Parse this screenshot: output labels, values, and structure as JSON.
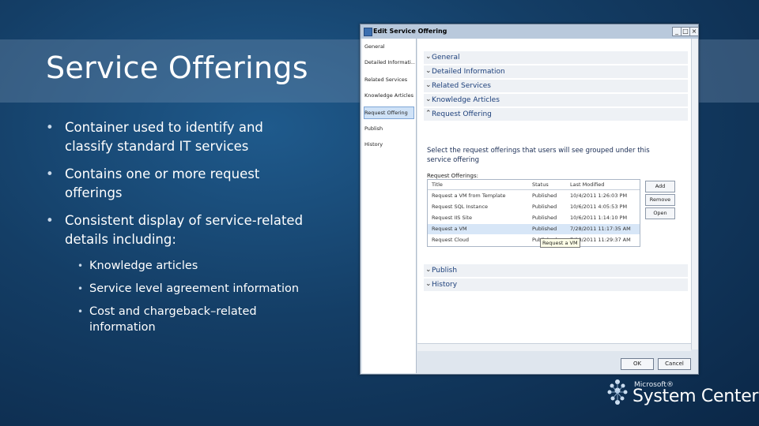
{
  "slide": {
    "title": "Service Offerings",
    "bullets": [
      {
        "text": "Container used to identify and classify standard IT services"
      },
      {
        "text": "Contains one or more request offerings"
      },
      {
        "text": "Consistent display of service-related details including:"
      }
    ],
    "sub_bullets": [
      {
        "text": "Knowledge articles"
      },
      {
        "text": "Service level agreement information"
      },
      {
        "text": "Cost and chargeback–related information"
      }
    ]
  },
  "dialog": {
    "title": "Edit Service Offering",
    "title_buttons": [
      "_",
      "□",
      "×"
    ],
    "nav": [
      "General",
      "Detailed Informati...",
      "Related Services",
      "Knowledge Articles",
      "Request Offering",
      "Publish",
      "History"
    ],
    "nav_selected": "Request Offering",
    "sections_top": [
      "General",
      "Detailed Information",
      "Related Services",
      "Knowledge Articles",
      "Request Offering"
    ],
    "description": "Select the request offerings that users will see grouped under this service offering",
    "grid_label": "Request Offerings:",
    "grid_columns": [
      "Title",
      "Status",
      "Last Modified"
    ],
    "grid_rows": [
      {
        "title": "Request a VM from Template",
        "status": "Published",
        "modified": "10/4/2011 1:26:03 PM"
      },
      {
        "title": "Request SQL Instance",
        "status": "Published",
        "modified": "10/6/2011 4:05:53 PM"
      },
      {
        "title": "Request IIS Site",
        "status": "Published",
        "modified": "10/6/2011 1:14:10 PM"
      },
      {
        "title": "Request a VM",
        "status": "Published",
        "modified": "7/28/2011 11:17:35 AM"
      },
      {
        "title": "Request Cloud",
        "status": "Published",
        "modified": "7/28/2011 11:29:37 AM"
      }
    ],
    "selected_row": "Request a VM",
    "tooltip": "Request a VM",
    "side_buttons": [
      "Add",
      "Remove",
      "Open"
    ],
    "sections_bottom": [
      "Publish",
      "History"
    ],
    "ok_label": "OK",
    "cancel_label": "Cancel"
  },
  "logo": {
    "line1": "Microsoft®",
    "line2": "System Center"
  },
  "colors": {
    "background": "#143e66",
    "accent": "#1c3f7a"
  }
}
